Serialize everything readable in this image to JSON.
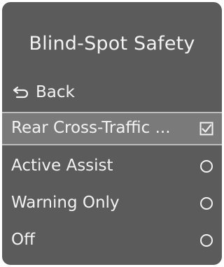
{
  "header": {
    "title": "Blind-Spot Safety"
  },
  "nav": {
    "back_label": "Back"
  },
  "menu": {
    "items": [
      {
        "label": "Rear Cross-Traffic ...",
        "control": "checkbox",
        "checked": true,
        "selected": true
      },
      {
        "label": "Active Assist",
        "control": "radio",
        "checked": false
      },
      {
        "label": "Warning Only",
        "control": "radio",
        "checked": false
      },
      {
        "label": "Off",
        "control": "radio",
        "checked": false
      }
    ]
  },
  "colors": {
    "background": "#5b5b5b",
    "highlight": "#7a7a7a",
    "text": "#f2f2f2"
  }
}
